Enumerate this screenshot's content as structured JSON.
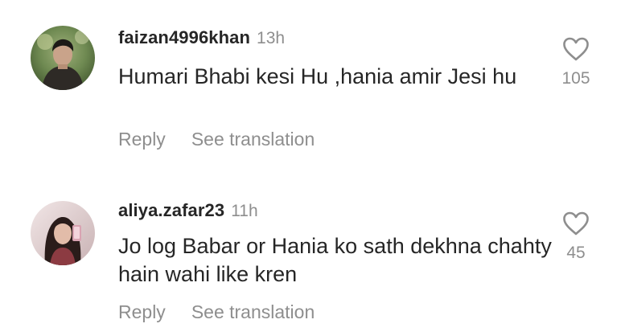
{
  "comments": [
    {
      "username": "faizan4996khan",
      "time": "13h",
      "text": "Humari Bhabi kesi Hu ,hania amir Jesi hu",
      "like_count": "105",
      "reply_label": "Reply",
      "translate_label": "See translation",
      "avatar_icon": "user-avatar-man",
      "like_icon": "heart-outline-icon"
    },
    {
      "username": "aliya.zafar23",
      "time": "11h",
      "text": "Jo log Babar or Hania ko sath dekhna chahty hain wahi like kren",
      "like_count": "45",
      "reply_label": "Reply",
      "translate_label": "See translation",
      "avatar_icon": "user-avatar-woman",
      "like_icon": "heart-outline-icon"
    }
  ],
  "colors": {
    "text_primary": "#262626",
    "text_secondary": "#8e8e8e",
    "background": "#ffffff"
  }
}
